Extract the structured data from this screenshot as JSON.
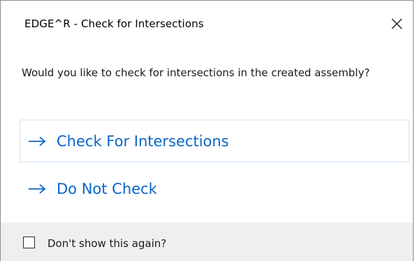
{
  "window": {
    "title": "EDGE^R - Check for Intersections"
  },
  "message": "Would you like to check for intersections in the created assembly?",
  "options": [
    {
      "label": "Check For Intersections",
      "icon": "arrow-right-icon"
    },
    {
      "label": "Do Not Check",
      "icon": "arrow-right-icon"
    }
  ],
  "footer": {
    "checkbox_label": "Don't show this again?",
    "checked": false
  },
  "colors": {
    "accent": "#0a64c8",
    "footer_bg": "#efefef",
    "primary_border": "#cfe3f5"
  }
}
